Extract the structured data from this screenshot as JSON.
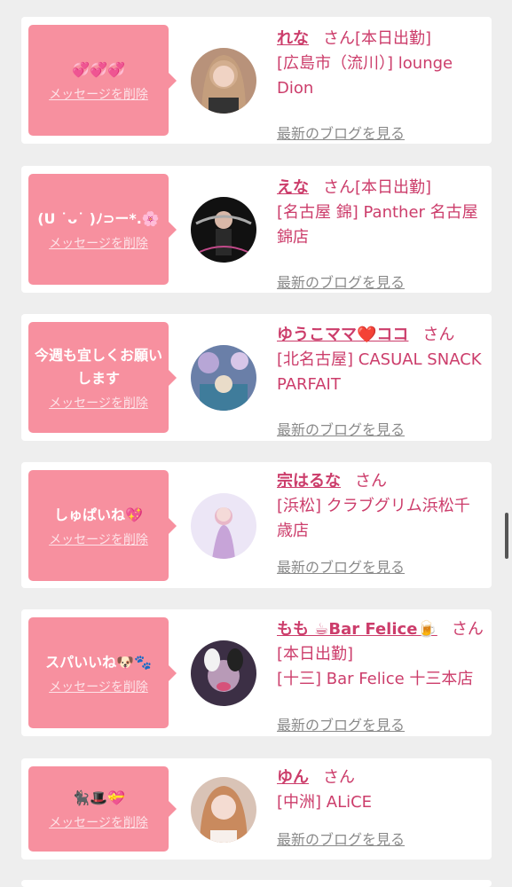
{
  "delete_label": "メッセージを削除",
  "blog_label": "最新のブログを見る",
  "honorific": "さん",
  "cards": [
    {
      "message": "💞💞💞",
      "name": "れな",
      "status": "[本日出勤]",
      "shop": "[広島市（流川）] lounge Dion"
    },
    {
      "message": "(U ˙ᴗ˙ )ﾉ⊃ー*.🌸",
      "name": "えな",
      "status": "[本日出勤]",
      "shop": "[名古屋 錦] Panther 名古屋錦店"
    },
    {
      "message": "今週も宜しくお願いします",
      "name": "ゆうこママ❤️ココ",
      "status": "",
      "shop": "[北名古屋] CASUAL SNACK PARFAIT"
    },
    {
      "message": "しゅぱいね💖",
      "name": "宗はるな",
      "status": "",
      "shop": "[浜松] クラブグリム浜松千歳店"
    },
    {
      "message": "スパいいね🐶🐾",
      "name": "もも ☕Bar Felice🍺",
      "status": "[本日出勤]",
      "shop": "[十三] Bar Felice 十三本店"
    },
    {
      "message": "🐈‍⬛🎩💝",
      "name": "ゆん",
      "status": "",
      "shop": "[中洲] ALiCE"
    }
  ],
  "colors": {
    "bubble": "#f7909f",
    "accent": "#cc3d6b",
    "link": "#8a8a8a"
  }
}
